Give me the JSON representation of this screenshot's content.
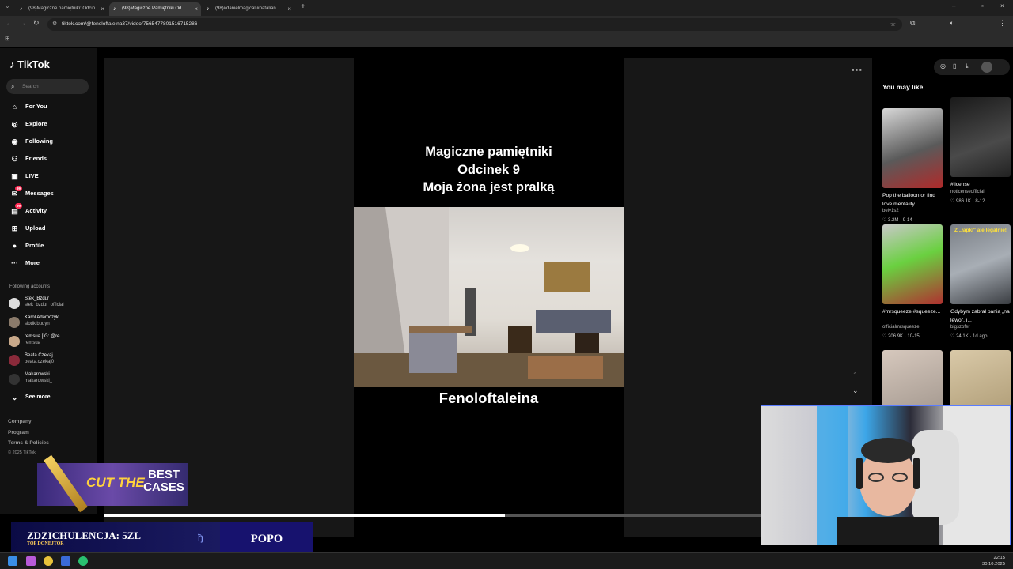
{
  "browser": {
    "tabs": [
      {
        "label": "(98)Magiczne pamiętniki: Odcin"
      },
      {
        "label": "(98)Magiczne Pamiętniki Od"
      },
      {
        "label": "(98)#danielmagical #natalian"
      }
    ],
    "url": "tiktok.com/@fenoloftaleina37/video/7565477801516715286"
  },
  "tiktok": {
    "logo": "TikTok",
    "search_placeholder": "Search",
    "nav": {
      "for_you": "For You",
      "explore": "Explore",
      "following": "Following",
      "friends": "Friends",
      "live": "LIVE",
      "messages": "Messages",
      "activity": "Activity",
      "upload": "Upload",
      "profile": "Profile",
      "more": "More"
    },
    "messages_badge": "99",
    "activity_badge": "99",
    "following_accounts_heading": "Following accounts",
    "accounts": [
      {
        "name": "Stek_Bzdur",
        "handle": "stek_bzdur_official"
      },
      {
        "name": "Karol Adamczyk",
        "handle": "slodkibudyn"
      },
      {
        "name": "remsua [IG: @re...",
        "handle": "remsua_"
      },
      {
        "name": "Beata Czekaj",
        "handle": "beata.czekaj0"
      },
      {
        "name": "Makarowski",
        "handle": "makarowski_"
      }
    ],
    "see_more": "See more",
    "footer": {
      "company": "Company",
      "program": "Program",
      "terms": "Terms & Policies",
      "copyright": "© 2025 TikTok"
    }
  },
  "video": {
    "title_line1": "Magiczne pamiętniki",
    "title_line2": "Odcinek 9",
    "title_line3": "Moja żona jest pralką",
    "caption": "Fenoloftaleina",
    "progress": 0.61
  },
  "right_panel": {
    "heading": "You may like",
    "cards": [
      {
        "title": "Pop the balloon or find love mentality...",
        "user": "belv1s2",
        "stats": "♡ 3.2M · 9-14",
        "thumb_color": "#6b6b6b"
      },
      {
        "title": "#license",
        "user": "noticenseofficial",
        "stats": "♡ 986.1K · 8-12",
        "thumb_color": "#2a2a2a"
      },
      {
        "title": "#mrsqueeze #squeeze...",
        "user": "officialmrsqueeze",
        "stats": "♡ 206.9K · 10-15",
        "thumb_color": "#7a8a6a"
      },
      {
        "title": "Gdybym zabrał panią „na lewo\", i...",
        "user": "bigszofer",
        "stats": "♡ 24.1K · 1d ago",
        "thumb_color": "#5f6368"
      },
      {
        "title": "",
        "user": "",
        "stats": "",
        "thumb_color": "#9a8f86"
      },
      {
        "title": "",
        "user": "",
        "stats": "",
        "thumb_color": "#b9a88e"
      }
    ],
    "thumb_overlay_text": "Z „łapki\" ale legalnie!"
  },
  "overlays": {
    "donation_text": "ZDZICHULENCJA: 5ZL",
    "donation_sub": "TOP DONEJTOR",
    "donation_name": "POPO",
    "promo_text1": "CUT THE",
    "promo_text2": "BEST CASES"
  },
  "taskbar": {
    "time": "22:15",
    "date": "30.10.2025"
  }
}
